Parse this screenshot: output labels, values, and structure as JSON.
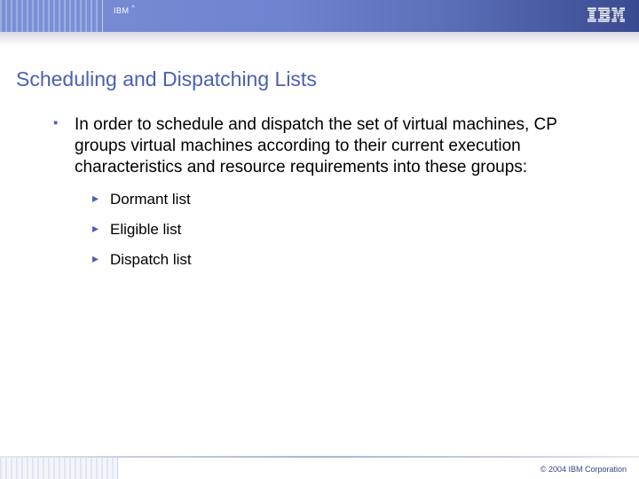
{
  "header": {
    "brand_small": "IBM",
    "brand_caret": "^",
    "logo_text": "IBM"
  },
  "title": "Scheduling and Dispatching Lists",
  "body": {
    "intro": "In order to schedule and dispatch the set of virtual machines, CP groups virtual machines according to their current execution characteristics and resource requirements into these groups:",
    "items": [
      "Dormant list",
      "Eligible list",
      "Dispatch list"
    ]
  },
  "footer": {
    "copyright": "© 2004 IBM Corporation"
  }
}
